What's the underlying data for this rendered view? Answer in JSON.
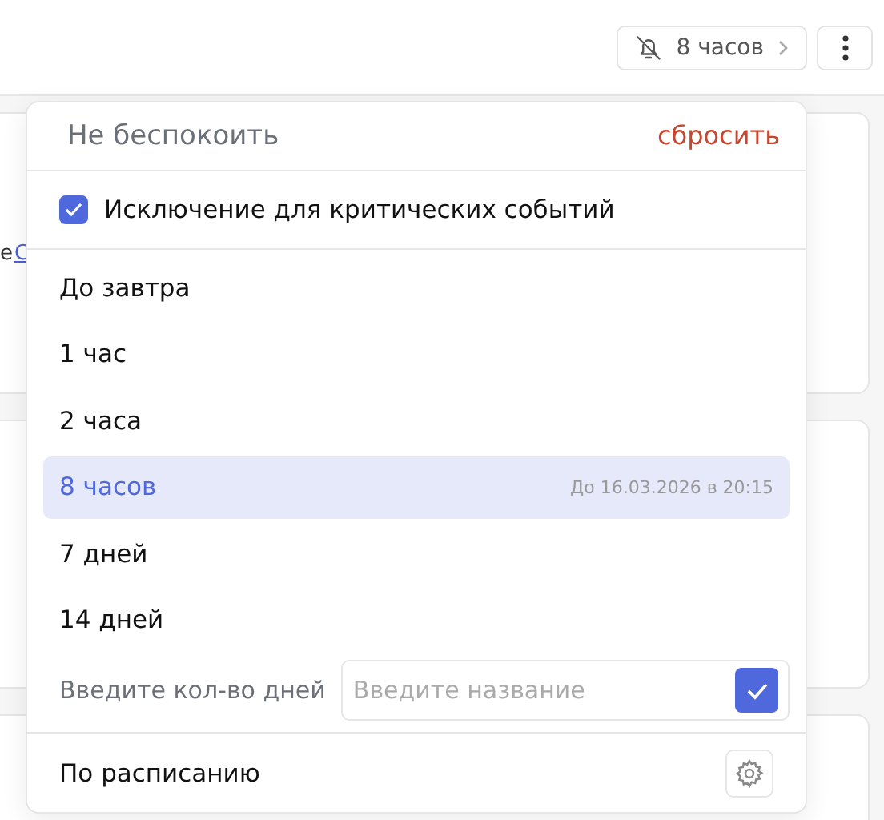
{
  "toolbar": {
    "dnd_button": {
      "label": "8 часов"
    }
  },
  "background": {
    "text_fragment": "е",
    "link_fragment": "С"
  },
  "popup": {
    "title": "Не беспокоить",
    "reset": "сбросить",
    "exception": {
      "label": "Исключение для критических событий",
      "checked": true
    },
    "options": [
      {
        "label": "До завтра",
        "selected": false
      },
      {
        "label": "1 час",
        "selected": false
      },
      {
        "label": "2 часа",
        "selected": false
      },
      {
        "label": "8 часов",
        "selected": true,
        "hint": "До 16.03.2026 в 20:15"
      },
      {
        "label": "7 дней",
        "selected": false
      },
      {
        "label": "14 дней",
        "selected": false
      }
    ],
    "custom": {
      "label": "Введите кол-во дней",
      "placeholder": "Введите название"
    },
    "schedule": {
      "label": "По расписанию"
    }
  }
}
